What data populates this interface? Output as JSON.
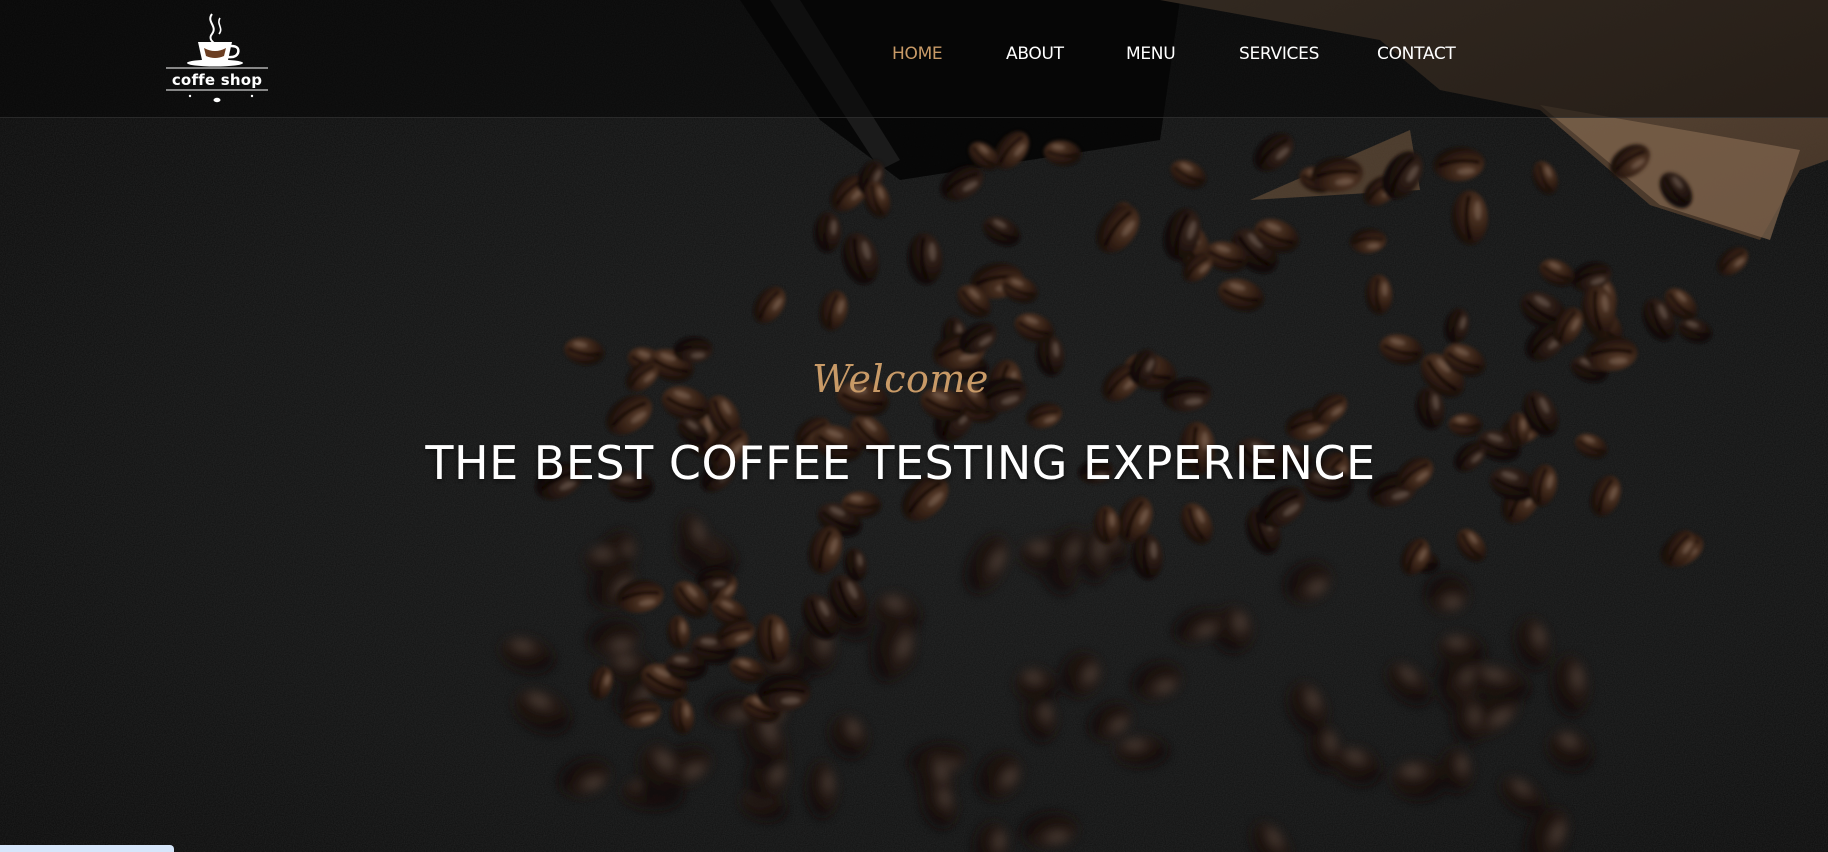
{
  "logo": {
    "text": "coffe shop",
    "icon": "coffee-cup-icon"
  },
  "nav": {
    "items": [
      {
        "label": "HOME",
        "active": true
      },
      {
        "label": "ABOUT",
        "active": false
      },
      {
        "label": "MENU",
        "active": false
      },
      {
        "label": "SERVICES",
        "active": false
      },
      {
        "label": "CONTACT",
        "active": false
      }
    ]
  },
  "hero": {
    "welcome": "Welcome",
    "headline": "THE BEST COFFEE TESTING EXPERIENCE"
  },
  "colors": {
    "accent": "#c89a67",
    "nav_text": "#ffffff",
    "background": "#0c0c0c"
  }
}
